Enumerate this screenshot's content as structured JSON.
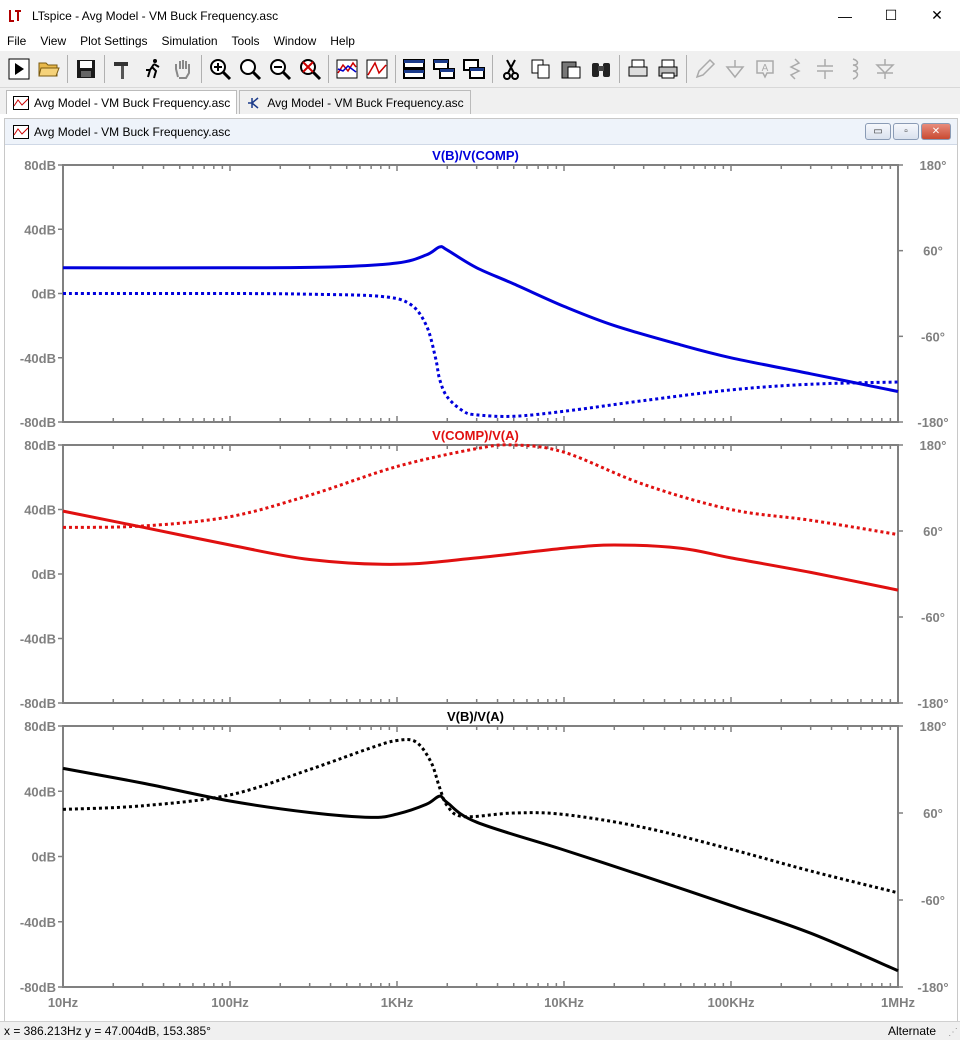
{
  "app": {
    "title": "LTspice - Avg Model - VM Buck Frequency.asc",
    "minimize": "—",
    "maximize": "☐",
    "close": "✕"
  },
  "menu": [
    "File",
    "View",
    "Plot Settings",
    "Simulation",
    "Tools",
    "Window",
    "Help"
  ],
  "toolbar": {
    "buttons": [
      "run",
      "open",
      "save",
      "control-panel",
      "halt",
      "pan",
      "zoom-in",
      "zoom-area",
      "zoom-out",
      "zoom-cancel",
      "autorange",
      "marker",
      "tile-horizontal",
      "tile-vertical",
      "cascade",
      "cut",
      "copy",
      "paste",
      "find",
      "print-setup",
      "print",
      "draw-wire",
      "ground",
      "label",
      "resistor",
      "capacitor",
      "inductor",
      "diode"
    ]
  },
  "tabs": [
    {
      "label": "Avg Model - VM Buck Frequency.asc",
      "kind": "waveform"
    },
    {
      "label": "Avg Model - VM Buck Frequency.asc",
      "kind": "schematic"
    }
  ],
  "window": {
    "title": "Avg Model - VM Buck Frequency.asc",
    "btn_min": "▭",
    "btn_max": "▫",
    "btn_close": "✕"
  },
  "axes": {
    "x_ticks": [
      "10Hz",
      "100Hz",
      "1KHz",
      "10KHz",
      "100KHz",
      "1MHz"
    ],
    "db_ticks": [
      "80dB",
      "40dB",
      "0dB",
      "-40dB",
      "-80dB"
    ],
    "phase_ticks": [
      "180°",
      "60°",
      "-60°",
      "-180°"
    ]
  },
  "colors": {
    "blue": "#0000dc",
    "red": "#e01010",
    "black": "#000000",
    "axis": "#808080"
  },
  "chart_data": [
    {
      "type": "line",
      "title": "V(B)/V(COMP)",
      "color": "#0000dc",
      "xscale": "log",
      "xlim": [
        10,
        1000000
      ],
      "ylim_db": [
        -80,
        80
      ],
      "ylim_phase": [
        -180,
        180
      ],
      "series": [
        {
          "name": "magnitude",
          "style": "solid",
          "x": [
            10,
            100,
            400,
            1000,
            1500,
            1800,
            2000,
            3000,
            5000,
            10000,
            20000,
            50000,
            100000,
            300000,
            1000000
          ],
          "y": [
            16,
            16,
            16.5,
            19,
            24,
            29,
            27,
            16,
            6,
            -8,
            -20,
            -32,
            -40,
            -50,
            -61
          ]
        },
        {
          "name": "phase",
          "style": "dotted",
          "x": [
            10,
            100,
            300,
            800,
            1200,
            1500,
            1700,
            1800,
            2000,
            2500,
            3000,
            5000,
            10000,
            30000,
            100000,
            300000,
            1000000
          ],
          "y": [
            0,
            0,
            -1,
            -4,
            -15,
            -45,
            -90,
            -120,
            -145,
            -165,
            -170,
            -172,
            -165,
            -150,
            -135,
            -127,
            -124
          ]
        }
      ]
    },
    {
      "type": "line",
      "title": "V(COMP)/V(A)",
      "color": "#e01010",
      "xscale": "log",
      "xlim": [
        10,
        1000000
      ],
      "ylim_db": [
        -80,
        80
      ],
      "ylim_phase": [
        -180,
        180
      ],
      "series": [
        {
          "name": "magnitude",
          "style": "solid",
          "x": [
            10,
            30,
            100,
            300,
            1000,
            3000,
            10000,
            20000,
            50000,
            100000,
            300000,
            1000000
          ],
          "y": [
            39,
            29,
            18,
            9,
            6,
            10,
            16,
            18,
            16,
            10,
            1,
            -10
          ]
        },
        {
          "name": "phase",
          "style": "dotted",
          "x": [
            10,
            30,
            100,
            300,
            1000,
            3000,
            5000,
            10000,
            30000,
            100000,
            300000,
            1000000
          ],
          "y": [
            65,
            67,
            80,
            110,
            150,
            175,
            180,
            170,
            125,
            90,
            75,
            55
          ]
        }
      ]
    },
    {
      "type": "line",
      "title": "V(B)/V(A)",
      "color": "#000000",
      "xscale": "log",
      "xlim": [
        10,
        1000000
      ],
      "ylim_db": [
        -80,
        80
      ],
      "ylim_phase": [
        -180,
        180
      ],
      "series": [
        {
          "name": "magnitude",
          "style": "solid",
          "x": [
            10,
            30,
            100,
            300,
            700,
            1000,
            1500,
            1800,
            2000,
            3000,
            10000,
            30000,
            100000,
            300000,
            1000000
          ],
          "y": [
            54,
            45,
            34,
            27,
            24,
            26,
            32,
            37,
            33,
            21,
            4,
            -12,
            -30,
            -47,
            -70
          ]
        },
        {
          "name": "phase",
          "style": "dotted",
          "x": [
            10,
            30,
            100,
            300,
            700,
            1000,
            1300,
            1600,
            1800,
            2000,
            2500,
            5000,
            10000,
            30000,
            100000,
            300000,
            1000000
          ],
          "y": [
            65,
            70,
            85,
            120,
            150,
            160,
            158,
            130,
            95,
            70,
            55,
            60,
            58,
            40,
            10,
            -20,
            -50
          ]
        }
      ]
    }
  ],
  "status": {
    "cursor": "x = 386.213Hz    y = 47.004dB, 153.385°",
    "mode": "Alternate"
  }
}
